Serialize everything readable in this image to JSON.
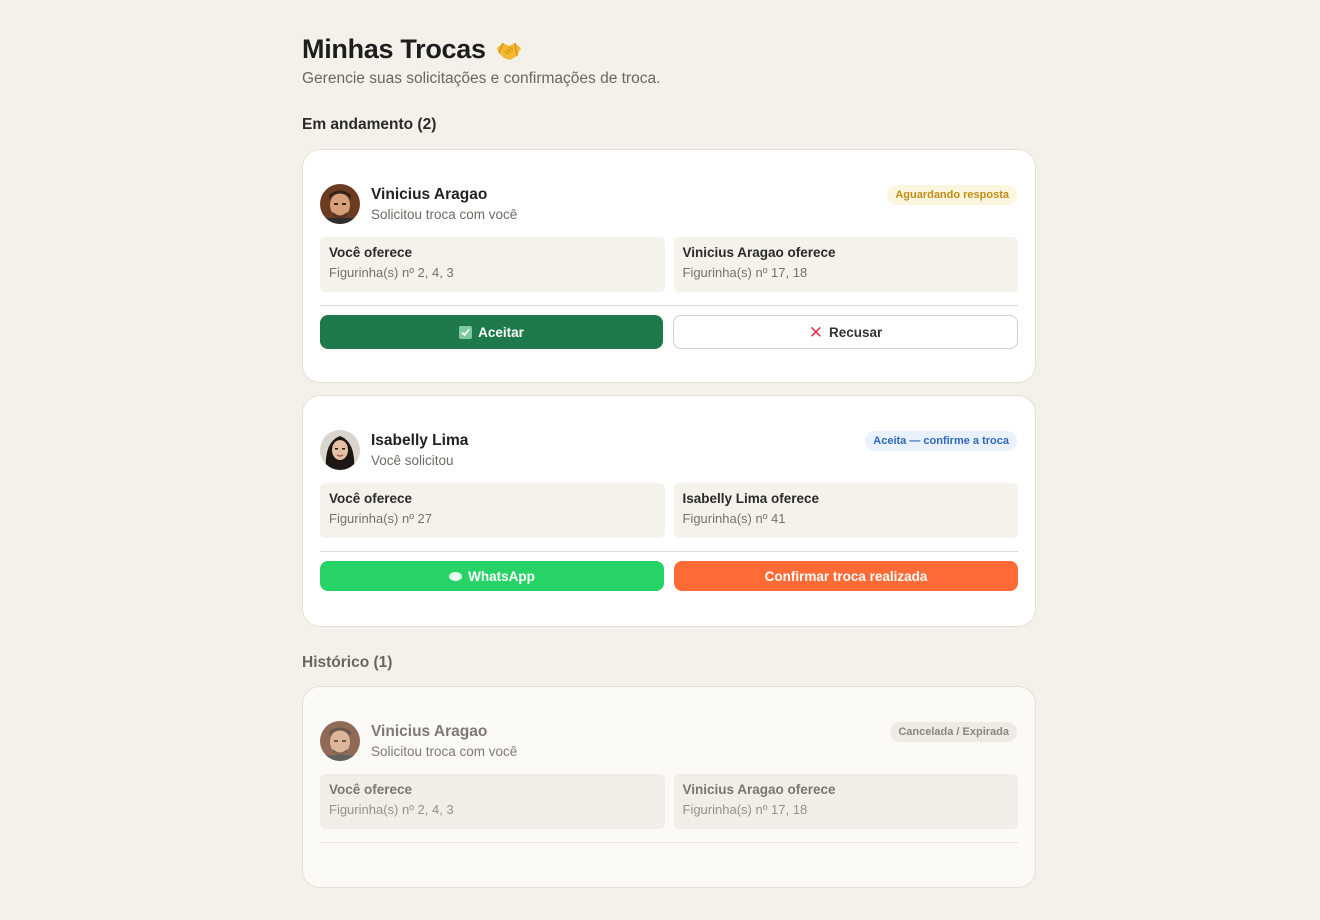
{
  "header": {
    "title": "Minhas Trocas",
    "subtitle": "Gerencie suas solicitações e confirmações de troca."
  },
  "sections": {
    "active_title": "Em andamento (2)",
    "history_title": "Histórico (1)"
  },
  "trades": [
    {
      "name": "Vinicius Aragao",
      "role": "Solicitou troca com você",
      "status": "Aguardando resposta",
      "you_offer_title": "Você oferece",
      "you_offer_value": "Figurinha(s) nº 2, 4, 3",
      "they_offer_title": "Vinicius Aragao oferece",
      "they_offer_value": "Figurinha(s) nº 17, 18",
      "accept_label": "Aceitar",
      "refuse_label": "Recusar"
    },
    {
      "name": "Isabelly Lima",
      "role": "Você solicitou",
      "status": "Aceita — confirme a troca",
      "you_offer_title": "Você oferece",
      "you_offer_value": "Figurinha(s) nº 27",
      "they_offer_title": "Isabelly Lima oferece",
      "they_offer_value": "Figurinha(s) nº 41",
      "whatsapp_label": "WhatsApp",
      "confirm_label": "Confirmar troca realizada"
    }
  ],
  "history": [
    {
      "name": "Vinicius Aragao",
      "role": "Solicitou troca com você",
      "status": "Cancelada / Expirada",
      "you_offer_title": "Você oferece",
      "you_offer_value": "Figurinha(s) nº 2, 4, 3",
      "they_offer_title": "Vinicius Aragao oferece",
      "they_offer_value": "Figurinha(s) nº 17, 18"
    }
  ],
  "icons": {
    "title_icon": "handshake-icon",
    "accept_icon": "check-icon",
    "refuse_icon": "x-icon",
    "whatsapp_icon": "chat-bubble-icon"
  },
  "colors": {
    "accept": "#1e7a4b",
    "whatsapp": "#27d367",
    "confirm": "#ff6b35",
    "refuse_icon": "#e03a5b"
  }
}
